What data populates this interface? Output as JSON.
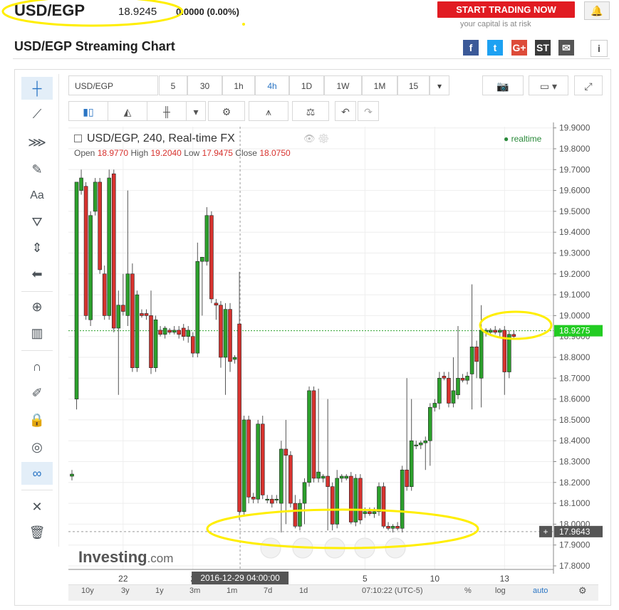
{
  "header": {
    "symbol": "USD/EGP",
    "price": "18.9245",
    "change": "0.0000",
    "change_pct": "(0.00%)",
    "trade_button": "START TRADING NOW",
    "risk_note": "your capital is at risk",
    "page_title": "USD/EGP Streaming Chart"
  },
  "share": [
    {
      "name": "facebook",
      "label": "f",
      "color": "#3b5998"
    },
    {
      "name": "twitter",
      "label": "t",
      "color": "#1da1f2"
    },
    {
      "name": "google-plus",
      "label": "G+",
      "color": "#dd4b39"
    },
    {
      "name": "stocktwits",
      "label": "ST",
      "color": "#3a3a3a"
    },
    {
      "name": "email",
      "label": "✉",
      "color": "#555555"
    },
    {
      "name": "info",
      "label": "i",
      "color": "#555555"
    }
  ],
  "toolbar": {
    "symbol_input": "USD/EGP",
    "intervals": [
      "5",
      "30",
      "1h",
      "4h",
      "1D",
      "1W",
      "1M",
      "15"
    ],
    "selected_interval": "4h"
  },
  "legend": {
    "name": "USD/EGP, 240, Real-time FX",
    "open_label": "Open",
    "open": "18.9770",
    "high_label": "High",
    "high": "19.2040",
    "low_label": "Low",
    "low": "17.9475",
    "close_label": "Close",
    "close": "18.0750",
    "status": "realtime"
  },
  "bottom_bar": {
    "ranges": [
      "10y",
      "3y",
      "1y",
      "3m",
      "1m",
      "7d",
      "1d"
    ],
    "clock": "07:10:22 (UTC-5)",
    "pct": "%",
    "log": "log",
    "auto": "auto"
  },
  "watermark": {
    "brand": "Investing",
    "suffix": ".com"
  },
  "colors": {
    "up": "#2ca02c",
    "down": "#d7322e",
    "accent": "#2a75c4",
    "trade": "#e11b22",
    "highlight": "#ffee00"
  },
  "chart_data": {
    "type": "candlestick",
    "y_axis_ticks": [
      "19.9000",
      "19.8000",
      "19.7000",
      "19.6000",
      "19.5000",
      "19.4000",
      "19.3000",
      "19.2000",
      "19.1000",
      "19.0000",
      "18.9000",
      "18.8000",
      "18.7000",
      "18.6000",
      "18.5000",
      "18.4000",
      "18.3000",
      "18.2000",
      "18.1000",
      "18.0000",
      "17.9000",
      "17.8000"
    ],
    "ylim": [
      17.75,
      19.92
    ],
    "x_tick_labels": [
      "22",
      "2",
      "5",
      "10",
      "13"
    ],
    "x_tick_index": [
      11,
      26,
      63,
      78,
      93
    ],
    "crosshair_label": "2016-12-29 04:00:00",
    "crosshair_index": 36,
    "last_price_label": "18.9275",
    "last_price": 18.9275,
    "cursor_price_label": "17.9643",
    "cursor_price": 17.9643,
    "candles": [
      {
        "o": 18.23,
        "h": 18.26,
        "l": 18.21,
        "c": 18.24
      },
      {
        "o": 18.6,
        "h": 19.1,
        "l": 18.55,
        "c": 19.64
      },
      {
        "o": 19.6,
        "h": 19.7,
        "l": 19.58,
        "c": 19.66
      },
      {
        "o": 19.62,
        "h": 19.64,
        "l": 18.98,
        "c": 19.0
      },
      {
        "o": 18.98,
        "h": 19.5,
        "l": 18.95,
        "c": 19.48
      },
      {
        "o": 19.5,
        "h": 19.66,
        "l": 19.48,
        "c": 19.64
      },
      {
        "o": 19.64,
        "h": 19.66,
        "l": 19.2,
        "c": 19.22
      },
      {
        "o": 19.2,
        "h": 19.24,
        "l": 18.98,
        "c": 19.0
      },
      {
        "o": 19.0,
        "h": 19.7,
        "l": 18.98,
        "c": 19.66
      },
      {
        "o": 19.68,
        "h": 19.7,
        "l": 18.92,
        "c": 18.94
      },
      {
        "o": 18.94,
        "h": 19.12,
        "l": 18.62,
        "c": 19.05
      },
      {
        "o": 19.05,
        "h": 19.2,
        "l": 19.0,
        "c": 19.02
      },
      {
        "o": 19.0,
        "h": 19.6,
        "l": 18.95,
        "c": 19.2
      },
      {
        "o": 19.2,
        "h": 19.25,
        "l": 18.73,
        "c": 18.75
      },
      {
        "o": 18.75,
        "h": 19.12,
        "l": 18.73,
        "c": 19.1
      },
      {
        "o": 19.01,
        "h": 19.03,
        "l": 18.99,
        "c": 19.0
      },
      {
        "o": 19.01,
        "h": 19.03,
        "l": 18.98,
        "c": 19.0
      },
      {
        "o": 19.0,
        "h": 19.12,
        "l": 18.72,
        "c": 18.75
      },
      {
        "o": 18.75,
        "h": 19.0,
        "l": 18.73,
        "c": 18.98
      },
      {
        "o": 18.93,
        "h": 18.95,
        "l": 18.9,
        "c": 18.91
      },
      {
        "o": 18.91,
        "h": 18.95,
        "l": 18.89,
        "c": 18.94
      },
      {
        "o": 18.93,
        "h": 18.94,
        "l": 18.91,
        "c": 18.92
      },
      {
        "o": 18.92,
        "h": 18.95,
        "l": 18.91,
        "c": 18.93
      },
      {
        "o": 18.93,
        "h": 18.95,
        "l": 18.89,
        "c": 18.91
      },
      {
        "o": 18.94,
        "h": 18.96,
        "l": 18.88,
        "c": 18.9
      },
      {
        "o": 18.9,
        "h": 18.95,
        "l": 18.87,
        "c": 18.93
      },
      {
        "o": 18.9,
        "h": 18.92,
        "l": 18.8,
        "c": 18.82
      },
      {
        "o": 18.82,
        "h": 19.35,
        "l": 18.8,
        "c": 19.26
      },
      {
        "o": 19.26,
        "h": 19.28,
        "l": 19.0,
        "c": 19.28
      },
      {
        "o": 19.26,
        "h": 19.52,
        "l": 19.24,
        "c": 19.48
      },
      {
        "o": 19.48,
        "h": 19.5,
        "l": 19.06,
        "c": 19.08
      },
      {
        "o": 19.06,
        "h": 19.08,
        "l": 18.98,
        "c": 19.05
      },
      {
        "o": 19.05,
        "h": 19.07,
        "l": 18.75,
        "c": 18.8
      },
      {
        "o": 18.8,
        "h": 19.06,
        "l": 18.62,
        "c": 19.03
      },
      {
        "o": 19.03,
        "h": 19.06,
        "l": 18.73,
        "c": 18.78
      },
      {
        "o": 18.79,
        "h": 18.81,
        "l": 18.77,
        "c": 18.8
      },
      {
        "o": 18.96,
        "h": 19.21,
        "l": 18.02,
        "c": 18.06
      },
      {
        "o": 18.06,
        "h": 18.52,
        "l": 18.04,
        "c": 18.5
      },
      {
        "o": 18.5,
        "h": 18.52,
        "l": 18.1,
        "c": 18.13
      },
      {
        "o": 18.13,
        "h": 18.15,
        "l": 18.1,
        "c": 18.12
      },
      {
        "o": 18.12,
        "h": 18.5,
        "l": 18.1,
        "c": 18.48
      },
      {
        "o": 18.48,
        "h": 18.52,
        "l": 18.12,
        "c": 18.14
      },
      {
        "o": 18.12,
        "h": 18.14,
        "l": 18.1,
        "c": 18.12
      },
      {
        "o": 18.12,
        "h": 18.14,
        "l": 18.08,
        "c": 18.1
      },
      {
        "o": 18.12,
        "h": 18.14,
        "l": 18.1,
        "c": 18.12
      },
      {
        "o": 18.1,
        "h": 18.4,
        "l": 17.96,
        "c": 18.36
      },
      {
        "o": 18.36,
        "h": 18.5,
        "l": 18.0,
        "c": 18.33
      },
      {
        "o": 18.33,
        "h": 18.35,
        "l": 18.08,
        "c": 18.1
      },
      {
        "o": 18.1,
        "h": 18.14,
        "l": 17.98,
        "c": 17.99
      },
      {
        "o": 17.99,
        "h": 18.12,
        "l": 17.97,
        "c": 18.1
      },
      {
        "o": 18.1,
        "h": 18.22,
        "l": 18.0,
        "c": 18.2
      },
      {
        "o": 18.2,
        "h": 18.66,
        "l": 18.18,
        "c": 18.64
      },
      {
        "o": 18.64,
        "h": 18.66,
        "l": 18.2,
        "c": 18.22
      },
      {
        "o": 18.22,
        "h": 18.65,
        "l": 18.2,
        "c": 18.25
      },
      {
        "o": 18.22,
        "h": 18.24,
        "l": 18.2,
        "c": 18.23
      },
      {
        "o": 18.23,
        "h": 18.6,
        "l": 17.97,
        "c": 18.18
      },
      {
        "o": 18.18,
        "h": 18.2,
        "l": 17.97,
        "c": 18.0
      },
      {
        "o": 18.0,
        "h": 18.26,
        "l": 17.98,
        "c": 18.22
      },
      {
        "o": 18.22,
        "h": 18.24,
        "l": 18.2,
        "c": 18.23
      },
      {
        "o": 18.22,
        "h": 18.24,
        "l": 18.21,
        "c": 18.23
      },
      {
        "o": 18.23,
        "h": 18.25,
        "l": 18.0,
        "c": 18.01
      },
      {
        "o": 18.01,
        "h": 18.24,
        "l": 17.99,
        "c": 18.22
      },
      {
        "o": 18.22,
        "h": 18.24,
        "l": 18.0,
        "c": 18.02
      },
      {
        "o": 18.05,
        "h": 18.08,
        "l": 18.03,
        "c": 18.06
      },
      {
        "o": 18.06,
        "h": 18.08,
        "l": 18.04,
        "c": 18.05
      },
      {
        "o": 18.05,
        "h": 18.08,
        "l": 18.03,
        "c": 18.06
      },
      {
        "o": 18.06,
        "h": 18.2,
        "l": 18.04,
        "c": 18.18
      },
      {
        "o": 18.18,
        "h": 18.2,
        "l": 17.98,
        "c": 17.99
      },
      {
        "o": 17.99,
        "h": 18.01,
        "l": 17.97,
        "c": 17.98
      },
      {
        "o": 17.98,
        "h": 18.0,
        "l": 17.96,
        "c": 17.99
      },
      {
        "o": 17.99,
        "h": 18.01,
        "l": 17.97,
        "c": 17.98
      },
      {
        "o": 17.98,
        "h": 18.28,
        "l": 17.96,
        "c": 18.26
      },
      {
        "o": 18.26,
        "h": 18.7,
        "l": 18.16,
        "c": 18.18
      },
      {
        "o": 18.18,
        "h": 18.6,
        "l": 18.16,
        "c": 18.4
      },
      {
        "o": 18.38,
        "h": 18.4,
        "l": 18.36,
        "c": 18.38
      },
      {
        "o": 18.38,
        "h": 18.4,
        "l": 18.36,
        "c": 18.39
      },
      {
        "o": 18.39,
        "h": 18.42,
        "l": 18.26,
        "c": 18.4
      },
      {
        "o": 18.4,
        "h": 18.58,
        "l": 18.28,
        "c": 18.56
      },
      {
        "o": 18.56,
        "h": 18.6,
        "l": 18.54,
        "c": 18.58
      },
      {
        "o": 18.58,
        "h": 18.73,
        "l": 18.55,
        "c": 18.7
      },
      {
        "o": 18.71,
        "h": 18.73,
        "l": 18.69,
        "c": 18.7
      },
      {
        "o": 18.7,
        "h": 18.73,
        "l": 18.56,
        "c": 18.58
      },
      {
        "o": 18.58,
        "h": 18.8,
        "l": 18.56,
        "c": 18.64
      },
      {
        "o": 18.62,
        "h": 18.95,
        "l": 18.6,
        "c": 18.7
      },
      {
        "o": 18.7,
        "h": 18.72,
        "l": 18.68,
        "c": 18.69
      },
      {
        "o": 18.69,
        "h": 18.73,
        "l": 18.67,
        "c": 18.71
      },
      {
        "o": 18.72,
        "h": 19.15,
        "l": 18.55,
        "c": 18.85
      },
      {
        "o": 18.85,
        "h": 18.88,
        "l": 18.7,
        "c": 18.78
      },
      {
        "o": 18.7,
        "h": 19.05,
        "l": 18.56,
        "c": 18.93
      },
      {
        "o": 18.92,
        "h": 18.94,
        "l": 18.9,
        "c": 18.93
      },
      {
        "o": 18.92,
        "h": 18.94,
        "l": 18.91,
        "c": 18.93
      },
      {
        "o": 18.93,
        "h": 18.95,
        "l": 18.91,
        "c": 18.92
      },
      {
        "o": 18.92,
        "h": 18.94,
        "l": 18.9,
        "c": 18.93
      },
      {
        "o": 18.93,
        "h": 18.95,
        "l": 18.62,
        "c": 18.73
      },
      {
        "o": 18.73,
        "h": 18.93,
        "l": 18.7,
        "c": 18.91
      },
      {
        "o": 18.91,
        "h": 18.93,
        "l": 18.89,
        "c": 18.9
      }
    ]
  }
}
